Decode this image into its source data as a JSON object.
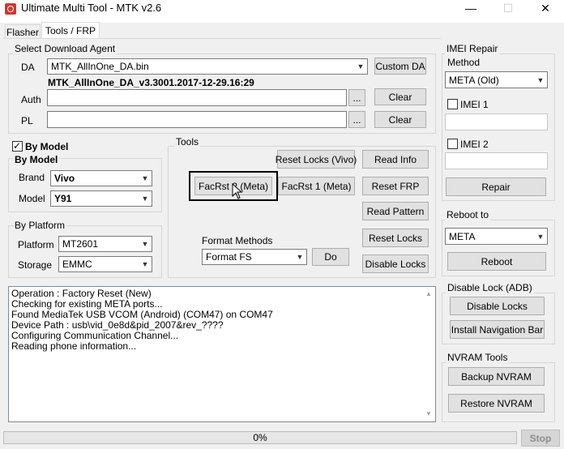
{
  "window": {
    "title": "Ultimate Multi Tool - MTK v2.6",
    "minimize": "—",
    "maximize": "☐",
    "close": "✕"
  },
  "tabs": [
    {
      "label": "Flasher"
    },
    {
      "label": "Tools / FRP"
    }
  ],
  "download_agent": {
    "group_label": "Select Download Agent",
    "da_label": "DA",
    "da_value": "MTK_AllInOne_DA.bin",
    "custom_da": "Custom DA",
    "da_info": "MTK_AllInOne_DA_v3.3001.2017-12-29.16:29",
    "auth_label": "Auth",
    "auth_value": "",
    "pl_label": "PL",
    "pl_value": "",
    "browse": "...",
    "clear": "Clear"
  },
  "by_model": {
    "checkbox_label": "By Model",
    "checked": true,
    "group_label": "By Model",
    "brand_label": "Brand",
    "brand_value": "Vivo",
    "model_label": "Model",
    "model_value": "Y91"
  },
  "by_platform": {
    "group_label": "By Platform",
    "platform_label": "Platform",
    "platform_value": "MT2601",
    "storage_label": "Storage",
    "storage_value": "EMMC"
  },
  "tools": {
    "group_label": "Tools",
    "reset_locks_vivo": "Reset Locks (Vivo)",
    "read_info": "Read Info",
    "facrst2": "FacRst 2 (Meta)",
    "facrst1": "FacRst 1 (Meta)",
    "reset_frp": "Reset FRP",
    "read_pattern": "Read Pattern",
    "reset_locks": "Reset Locks",
    "disable_locks": "Disable Locks",
    "format_label": "Format Methods",
    "format_value": "Format FS",
    "do": "Do"
  },
  "imei": {
    "group_label": "IMEI Repair",
    "method_label": "Method",
    "method_value": "META (Old)",
    "imei1_label": "IMEI 1",
    "imei2_label": "IMEI 2",
    "imei1_value": "",
    "imei2_value": "",
    "repair": "Repair"
  },
  "reboot": {
    "group_label": "Reboot to",
    "mode_value": "META",
    "reboot": "Reboot"
  },
  "adb": {
    "group_label": "Disable Lock (ADB)",
    "disable_locks": "Disable Locks",
    "install_nav": "Install Navigation Bar"
  },
  "nvram": {
    "group_label": "NVRAM Tools",
    "backup": "Backup NVRAM",
    "restore": "Restore NVRAM"
  },
  "log": [
    "Operation : Factory Reset (New)",
    "Checking for existing META ports...",
    "Found MediaTek USB VCOM (Android) (COM47) on COM47",
    "Device Path : usb\\vid_0e8d&pid_2007&rev_????",
    "Configuring Communication Channel...",
    "Reading phone information..."
  ],
  "progress": {
    "value": 0,
    "text": "0%"
  },
  "stop": "Stop"
}
